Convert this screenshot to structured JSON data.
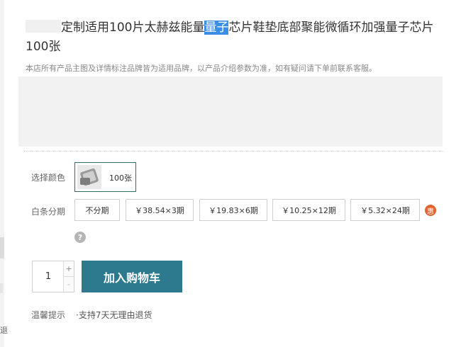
{
  "product": {
    "title_part1": "定制适用100片太赫兹能量",
    "title_highlight": "量子",
    "title_part2": "芯片鞋垫底部聚能微循环加强量子芯片 100张",
    "notice": "本店所有产品主图及详情标注品牌皆为适用品牌，以产品介绍参数为准，如有疑问请下单前联系客服。"
  },
  "color_selector": {
    "label": "选择颜色",
    "options": [
      {
        "label": "100张",
        "selected": true
      }
    ]
  },
  "installment": {
    "label": "白条分期",
    "options": [
      {
        "label": "不分期"
      },
      {
        "label": "￥38.54×3期"
      },
      {
        "label": "￥19.83×6期"
      },
      {
        "label": "￥10.25×12期"
      },
      {
        "label": "￥5.32×24期"
      }
    ],
    "discount_badge": "惠",
    "help_symbol": "?"
  },
  "purchase": {
    "quantity": "1",
    "increment": "+",
    "decrement": "-",
    "add_to_cart": "加入购物车"
  },
  "tips": {
    "label": "温馨提示",
    "text": "·支持7天无理由退货"
  },
  "edge": {
    "glyph": "退"
  },
  "colors": {
    "accent": "#2d7a8e",
    "highlight": "#3a8ee6",
    "badge": "#e4612d"
  }
}
